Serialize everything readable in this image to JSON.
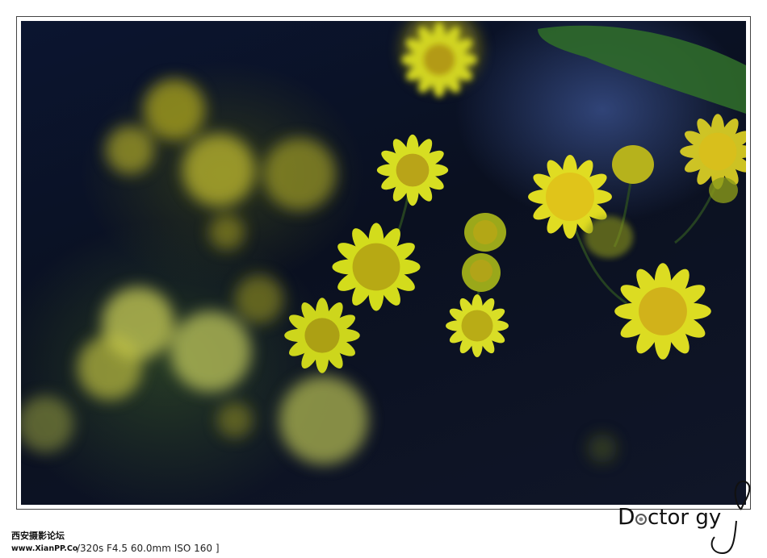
{
  "photo": {
    "subject": "yellow daisy-like flowers",
    "palette": {
      "background": "#0a1020",
      "petal": "#d8dc1c",
      "center": "#b7a612",
      "leaf": "#2f6a2a"
    }
  },
  "caption": {
    "exif_text": "/320s F4.5 60.0mm ISO 160 ]"
  },
  "watermarks": {
    "site_name": "西安摄影论坛",
    "site_url": "www.XianPP.Com",
    "signature": "Doctor gy"
  }
}
